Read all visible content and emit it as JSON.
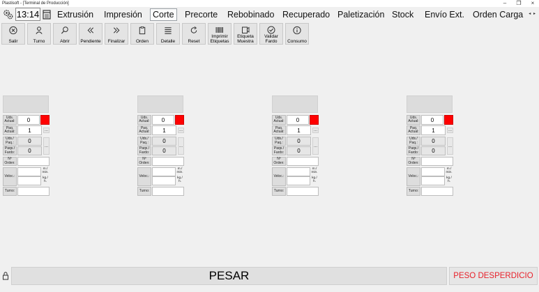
{
  "window": {
    "title": "Plastisoft - [Terminal de Producción]",
    "minimize_glyph": "–",
    "restore_glyph": "❐",
    "close_glyph": "×"
  },
  "menu": {
    "clock": "13:14",
    "items": [
      "Extrusión",
      "Impresión",
      "Corte",
      "Precorte",
      "Rebobinado",
      "Recuperado",
      "Paletización",
      "Stock",
      "Envío Ext.",
      "Orden Carga"
    ],
    "active": "Corte",
    "scroll_arrows": "◂ ▸"
  },
  "toolbar": {
    "buttons": [
      {
        "label": "Salir",
        "icon": "close-circle-icon"
      },
      {
        "label": "Turno",
        "icon": "user-icon"
      },
      {
        "label": "Abrir",
        "icon": "search-icon"
      },
      {
        "label": "Pendiente",
        "icon": "chevrons-left-icon"
      },
      {
        "label": "Finalizar",
        "icon": "chevrons-right-icon"
      },
      {
        "label": "Orden",
        "icon": "clipboard-icon"
      },
      {
        "label": "Detalle",
        "icon": "list-icon"
      },
      {
        "label": "Reset",
        "icon": "refresh-icon"
      },
      {
        "label": "Imprimir Etiquetas",
        "icon": "barcode-icon"
      },
      {
        "label": "Etiqueta Muestra",
        "icon": "sample-label-icon"
      },
      {
        "label": "Validar Fardo",
        "icon": "check-circle-icon"
      },
      {
        "label": "Consumo",
        "icon": "info-circle-icon"
      }
    ]
  },
  "station_labels": {
    "uds_actual": "Uds. Actual:",
    "paq_actual": "Paq. Actual:",
    "uds_paq": "Uds./ Paq.:",
    "paqs_fardo": "Paqs./ Fardo:",
    "n_orden": "Nº Orden:",
    "veloc": "Veloc.:",
    "unit_m_min": "m./ min.",
    "unit_kg_h": "kg./ h.",
    "turno": "Turno:",
    "dots": "..."
  },
  "stations": [
    {
      "uds_actual": "0",
      "paq_actual": "1",
      "uds_paq": "0",
      "paqs_fardo": "0",
      "n_orden": "",
      "veloc_m_min": "",
      "veloc_kg_h": "",
      "turno": ""
    },
    {
      "uds_actual": "0",
      "paq_actual": "1",
      "uds_paq": "0",
      "paqs_fardo": "0",
      "n_orden": "",
      "veloc_m_min": "",
      "veloc_kg_h": "",
      "turno": ""
    },
    {
      "uds_actual": "0",
      "paq_actual": "1",
      "uds_paq": "0",
      "paqs_fardo": "0",
      "n_orden": "",
      "veloc_m_min": "",
      "veloc_kg_h": "",
      "turno": ""
    },
    {
      "uds_actual": "0",
      "paq_actual": "1",
      "uds_paq": "0",
      "paqs_fardo": "0",
      "n_orden": "",
      "veloc_m_min": "",
      "veloc_kg_h": "",
      "turno": ""
    }
  ],
  "bottom": {
    "pesar": "PESAR",
    "peso_desperdicio": "PESO DESPERDICIO"
  },
  "colors": {
    "status_red": "#ff0000",
    "peso_desperdicio_text": "#e8202a"
  }
}
